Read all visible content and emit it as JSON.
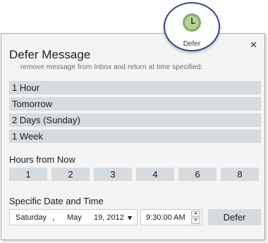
{
  "dialog": {
    "title": "Defer Message",
    "subtitle": "remove message from Inbox and return at time specified:",
    "close_label": "✕",
    "quick_options": [
      "1 Hour",
      "Tomorrow",
      "2 Days (Sunday)",
      "1 Week"
    ],
    "hours_label": "Hours from Now",
    "hours": [
      "1",
      "2",
      "3",
      "4",
      "6",
      "8"
    ],
    "specific_label": "Specific Date and Time",
    "date": {
      "weekday": "Saturday",
      "sep": ",",
      "month": "May",
      "day_year": "19, 2012",
      "dropdown_glyph": "▾"
    },
    "time": {
      "value": "9:30:00 AM",
      "up_glyph": "▲",
      "down_glyph": "▼"
    },
    "defer_button": "Defer"
  },
  "callout": {
    "label": "Defer",
    "icon": "clock-icon",
    "color_outer": "#89b06c",
    "color_inner": "#b9d39b"
  }
}
